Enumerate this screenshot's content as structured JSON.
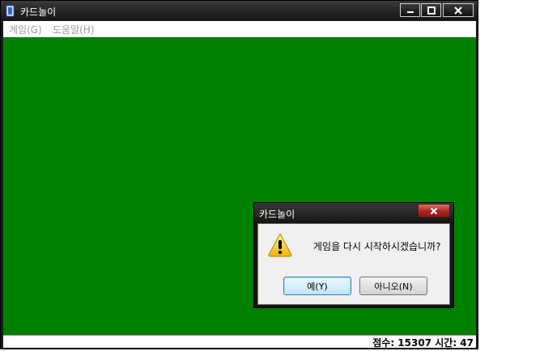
{
  "window": {
    "title": "카드놀이",
    "icon": "card-deck-icon"
  },
  "menu": {
    "items": [
      {
        "label": "게임(G)"
      },
      {
        "label": "도움말(H)"
      }
    ]
  },
  "status": {
    "text": "점수: 15307 시간: 47"
  },
  "dialog": {
    "title": "카드놀이",
    "icon": "warning-icon",
    "message": "게임을 다시 시작하시겠습니까?",
    "buttons": {
      "yes": "예(Y)",
      "no": "아니오(N)"
    }
  },
  "colors": {
    "felt": "#008000",
    "titlebar": "#141414",
    "dialog_close": "#c0392b"
  }
}
